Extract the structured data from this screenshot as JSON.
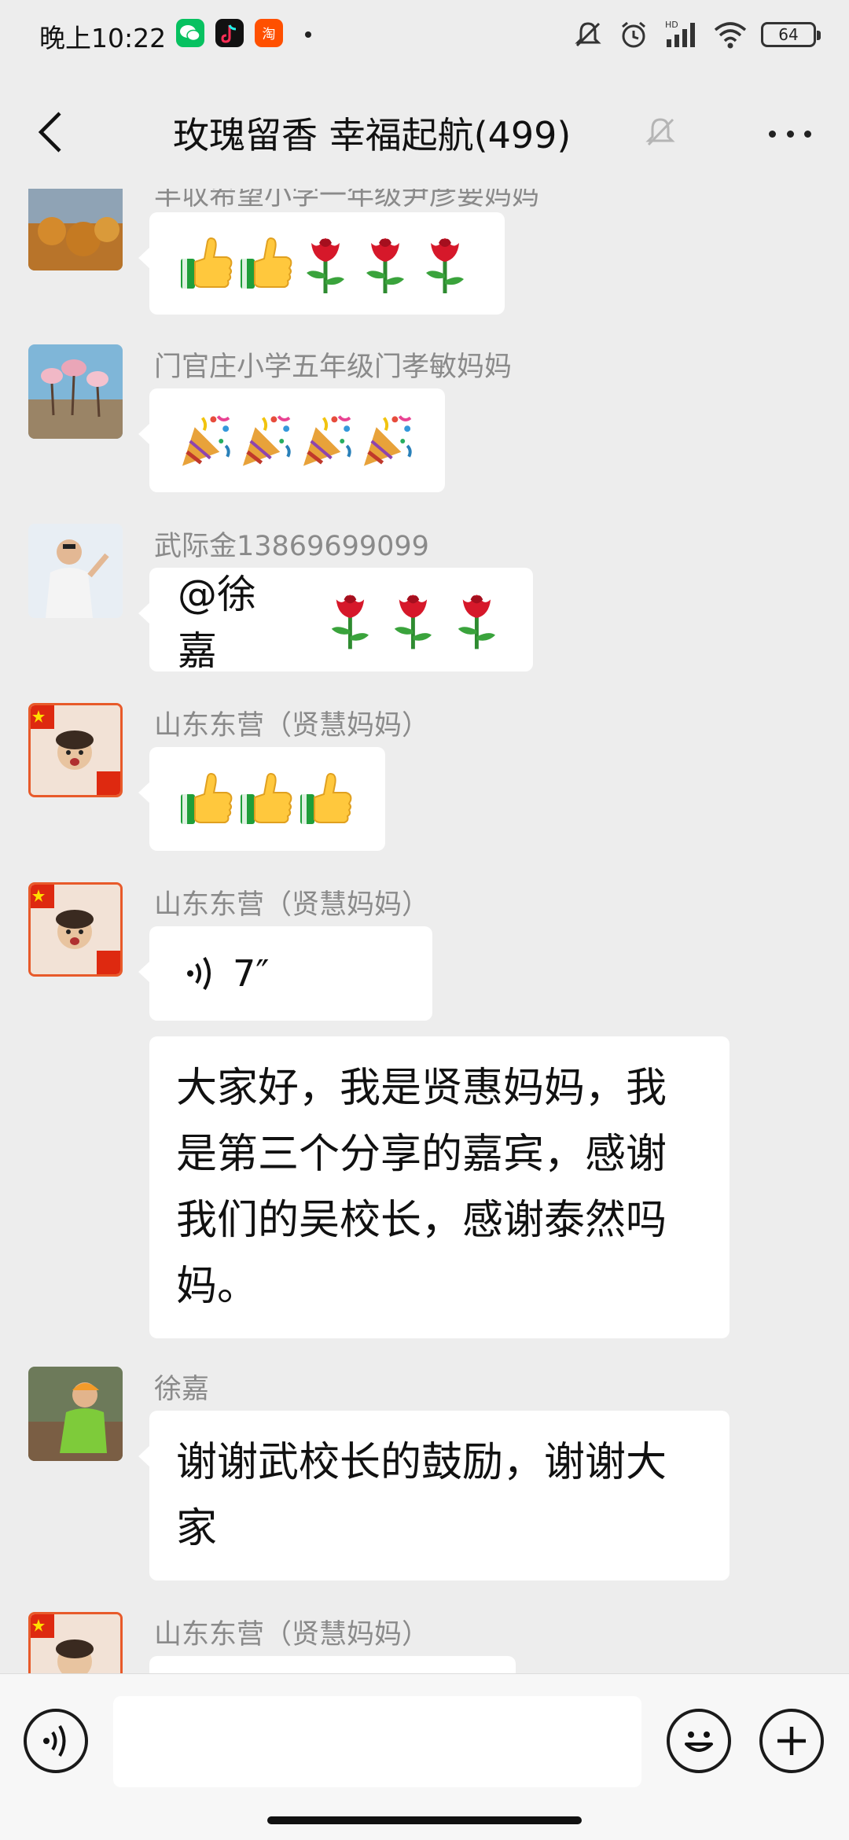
{
  "status_bar": {
    "time": "晚上10:22",
    "battery": "64",
    "icons": [
      "wechat-icon",
      "tiktok-icon",
      "taobao-icon",
      "mute-bell-icon",
      "alarm-icon",
      "signal-icon",
      "wifi-icon",
      "battery-icon"
    ],
    "hd_label": "HD"
  },
  "header": {
    "title": "玫瑰留香  幸福起航(499)",
    "back_icon": "chevron-left-icon",
    "muted_icon": "bell-off-icon",
    "more_icon": "more-dots-icon"
  },
  "messages": [
    {
      "sender": "丰収希望小学一年级尹彦要妈妈",
      "type": "emoji",
      "emojis": [
        "thumbs-up",
        "thumbs-up",
        "rose",
        "rose",
        "rose"
      ]
    },
    {
      "sender": "门官庄小学五年级门孝敏妈妈",
      "type": "emoji",
      "emojis": [
        "party-popper",
        "party-popper",
        "party-popper",
        "party-popper"
      ]
    },
    {
      "sender": "武际金13869699099",
      "type": "mixed",
      "text": "@徐嘉",
      "emojis": [
        "rose",
        "rose",
        "rose"
      ]
    },
    {
      "sender": "山东东营（贤慧妈妈）",
      "type": "emoji",
      "emojis": [
        "thumbs-up",
        "thumbs-up",
        "thumbs-up"
      ]
    },
    {
      "sender": "山东东营（贤慧妈妈）",
      "type": "voice",
      "duration": "7″"
    },
    {
      "type": "text",
      "text": "大家好，我是贤惠妈妈，我是第三个分享的嘉宾，感谢我们的吴校长，感谢泰然吗妈。"
    },
    {
      "sender": "徐嘉",
      "type": "text",
      "text": "谢谢武校长的鼓励，谢谢大家"
    },
    {
      "sender": "山东东营（贤慧妈妈）",
      "type": "partial"
    }
  ],
  "input_bar": {
    "voice_icon": "voice-input-icon",
    "emoji_icon": "smiley-icon",
    "plus_icon": "plus-icon",
    "placeholder": ""
  },
  "colors": {
    "background": "#ededed",
    "bubble": "#ffffff",
    "sender": "#8a8a8a",
    "input_bar": "#f7f7f7"
  }
}
